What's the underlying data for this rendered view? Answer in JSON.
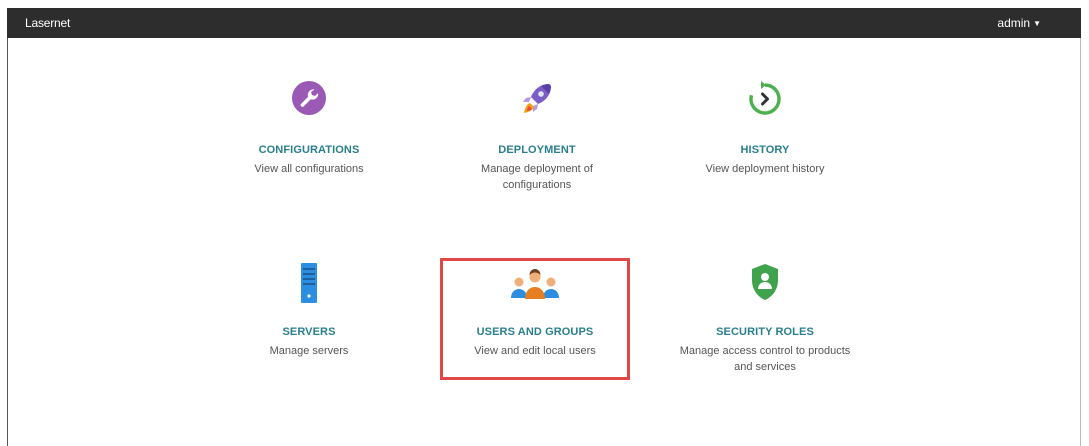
{
  "header": {
    "brand": "Lasernet",
    "user_label": "admin"
  },
  "tiles": [
    {
      "title": "CONFIGURATIONS",
      "description": "View all configurations",
      "icon": "wrench-icon"
    },
    {
      "title": "DEPLOYMENT",
      "description": "Manage deployment of configurations",
      "icon": "rocket-icon"
    },
    {
      "title": "HISTORY",
      "description": "View deployment history",
      "icon": "history-icon"
    },
    {
      "title": "SERVERS",
      "description": "Manage servers",
      "icon": "server-icon"
    },
    {
      "title": "USERS AND GROUPS",
      "description": "View and edit local users",
      "icon": "users-icon"
    },
    {
      "title": "SECURITY ROLES",
      "description": "Manage access control to products and services",
      "icon": "shield-user-icon"
    }
  ],
  "colors": {
    "topbar": "#2d2d2d",
    "title_teal": "#2a7f8c",
    "highlight_red": "#e04848",
    "wrench_purple": "#9b59b6",
    "history_green": "#4caf50",
    "server_blue": "#2b8ee0",
    "shield_green": "#3fa34d"
  }
}
